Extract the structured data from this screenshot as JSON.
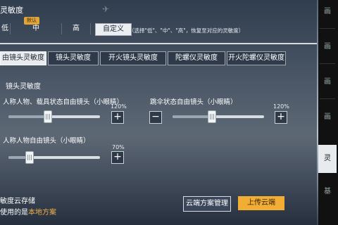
{
  "top": {
    "section_title": "灵敏度",
    "default_badge": "默认",
    "options": [
      "低",
      "中",
      "高",
      "自定义"
    ],
    "selected": "自定义",
    "note": "（选择\"低\"、\"中\"、\"高\"，恢复至对应的灵敏度）"
  },
  "tabs": [
    "由镜头灵敏度",
    "镜头灵敏度",
    "开火镜头灵敏度",
    "陀螺仪灵敏度",
    "开火陀螺仪灵敏度"
  ],
  "active_tab": 0,
  "sub_title": "镜头灵敏度",
  "settings": [
    {
      "label": "人称人物、载具状态自由镜头（小眼睛）",
      "percent": "120%",
      "value": 0.42
    },
    {
      "label": "跳伞状态自由镜头（小眼睛）",
      "percent": "120%",
      "value": 0.42
    },
    {
      "label": "人称人物自由镜头（小眼睛）",
      "percent": "70%",
      "value": 0.22
    }
  ],
  "bottom": {
    "storage_title": "敏度云存储",
    "using_prefix": "使用的是",
    "using_value": "本地方案",
    "cloud_manage": "云端方案管理",
    "upload": "上传云端"
  },
  "rightbar": {
    "labels": [
      "画",
      "画",
      "画",
      "画",
      "灵",
      "基"
    ],
    "active_label": "灵"
  }
}
